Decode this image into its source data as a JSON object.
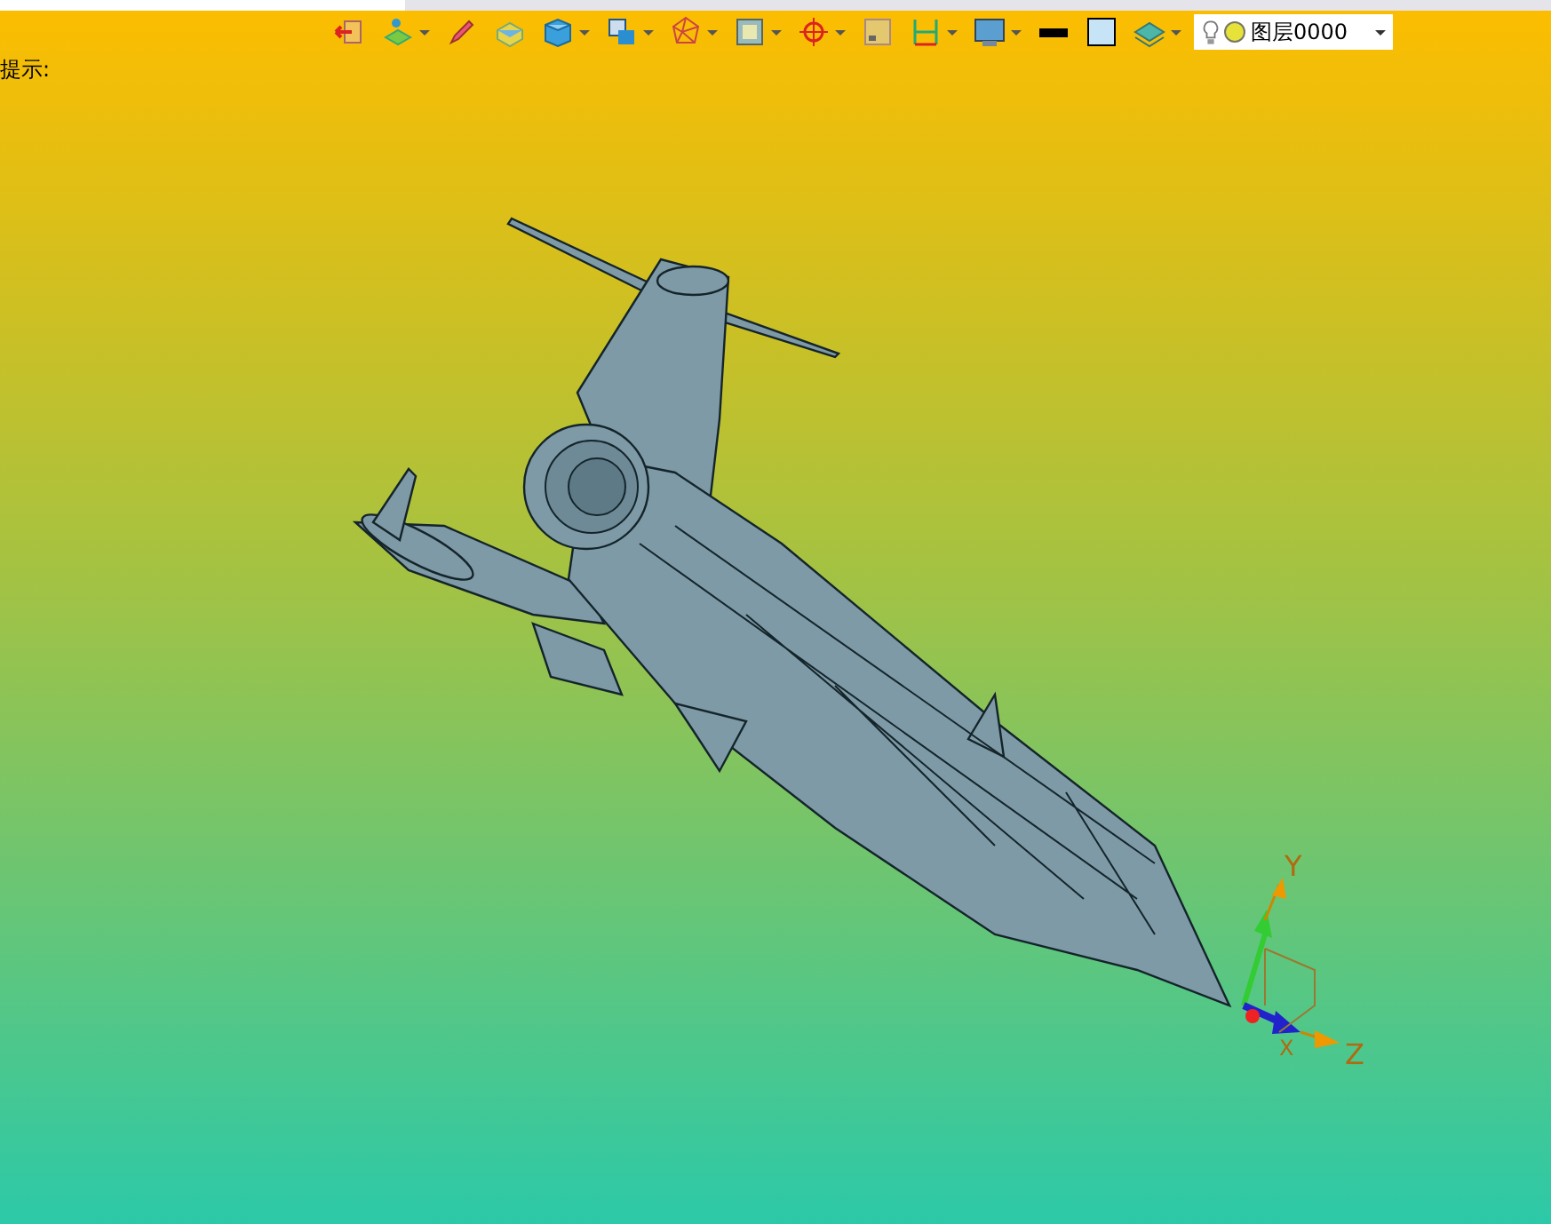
{
  "toolbar": {
    "items": [
      {
        "kind": "exit",
        "dropdown": false
      },
      {
        "kind": "layers-green",
        "dropdown": true
      },
      {
        "kind": "pen",
        "dropdown": false
      },
      {
        "kind": "yellow-box",
        "dropdown": false
      },
      {
        "kind": "cube",
        "dropdown": true
      },
      {
        "kind": "box-view",
        "dropdown": true
      },
      {
        "kind": "wire-sphere",
        "dropdown": true
      },
      {
        "kind": "frame",
        "dropdown": true
      },
      {
        "kind": "crosshair",
        "dropdown": true
      },
      {
        "kind": "small-square",
        "dropdown": false
      },
      {
        "kind": "dimension",
        "dropdown": true
      },
      {
        "kind": "monitor",
        "dropdown": true
      },
      {
        "kind": "line-color",
        "dropdown": false
      },
      {
        "kind": "fill-color",
        "dropdown": false
      },
      {
        "kind": "layer-stack",
        "dropdown": true
      }
    ],
    "layer_select": {
      "value": "图层0000"
    }
  },
  "hint": "提示:",
  "axes": {
    "y": "Y",
    "z": "Z",
    "x": "X"
  }
}
